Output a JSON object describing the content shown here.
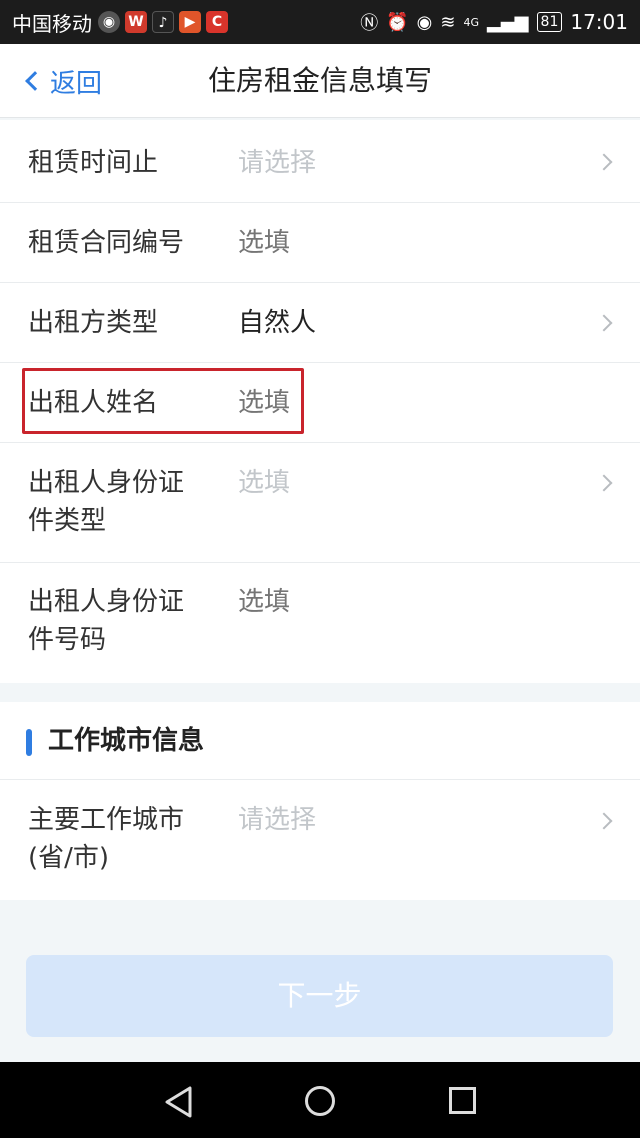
{
  "status_bar": {
    "carrier": "中国移动",
    "app_icons": [
      "◉",
      "W",
      "♪",
      "▶",
      "C"
    ],
    "network": "4G",
    "battery": "81",
    "time": "17:01"
  },
  "nav": {
    "back_label": "返回",
    "title": "住房租金信息填写"
  },
  "form": {
    "rows": [
      {
        "label": "租赁时间止",
        "value": "请选择"
      },
      {
        "label": "租赁合同编号",
        "value": "选填"
      },
      {
        "label": "出租方类型",
        "value": "自然人"
      },
      {
        "label": "出租人姓名",
        "value": "选填"
      },
      {
        "label": "出租人身份证件类型",
        "value": "选填"
      },
      {
        "label": "出租人身份证件号码",
        "value": "选填"
      }
    ]
  },
  "work_city_section": {
    "title": "工作城市信息",
    "label": "主要工作城市(省/市)",
    "value": "请选择"
  },
  "next_button": "下一步"
}
